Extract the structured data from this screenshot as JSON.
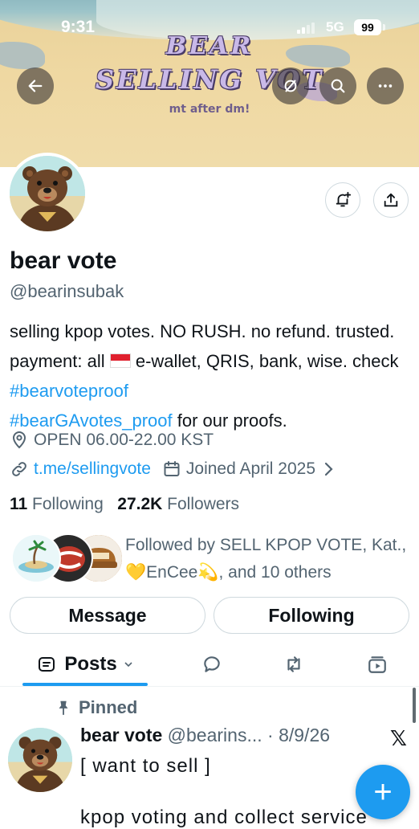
{
  "status_bar": {
    "time": "9:31",
    "network": "5G",
    "battery": "99"
  },
  "banner": {
    "title_line1": "BEAR",
    "title_line2": "SELLING VOT",
    "subtitle": "mt after dm!"
  },
  "icons": {
    "back": "arrow-left-icon",
    "mute": "slashed-circle-icon",
    "search": "search-icon",
    "more": "more-icon",
    "notify": "bell-plus-icon",
    "share": "share-icon",
    "location": "location-pin-icon",
    "link": "link-icon",
    "calendar": "calendar-icon",
    "chevron": "chevron-right-icon",
    "posts": "posts-icon",
    "reply": "reply-icon",
    "repost": "repost-icon",
    "media": "media-icon",
    "pin": "pin-icon",
    "x_logo": "x-logo-icon",
    "compose": "plus-icon"
  },
  "profile": {
    "name": "bear vote",
    "handle": "@bearinsubak",
    "bio": {
      "part1": "selling kpop votes. NO RUSH. no refund. trusted. payment: all ",
      "part2": " e-wallet, QRIS, bank, wise. check ",
      "hashtag1": "#bearvoteproof",
      "hashtag2": "#bearGAvotes_proof",
      "part3": " for our proofs."
    },
    "location": "OPEN 06.00-22.00 KST",
    "link": "t.me/sellingvote",
    "joined": "Joined April 2025",
    "following_count": "11",
    "following_label": "Following",
    "followers_count": "27.2K",
    "followers_label": "Followers",
    "followed_by": {
      "prefix": "Followed by ",
      "name1": "SELL KPOP VOTE",
      "sep1": ", ",
      "name2": "Kat.",
      "sep2": ", ",
      "name3": "💛EnCee💫",
      "suffix": ", and 10 others"
    },
    "buttons": {
      "message": "Message",
      "following": "Following"
    }
  },
  "tabs": {
    "posts": "Posts"
  },
  "colors": {
    "accent": "#1d9bf0",
    "text": "#0f1419",
    "muted": "#536471"
  },
  "post": {
    "pinned_label": "Pinned",
    "author": "bear vote",
    "handle": "@bearins...",
    "dot": " · ",
    "date": "8/9/26",
    "line1": "[ want to sell ]",
    "line2": "kpop voting and collect service"
  }
}
